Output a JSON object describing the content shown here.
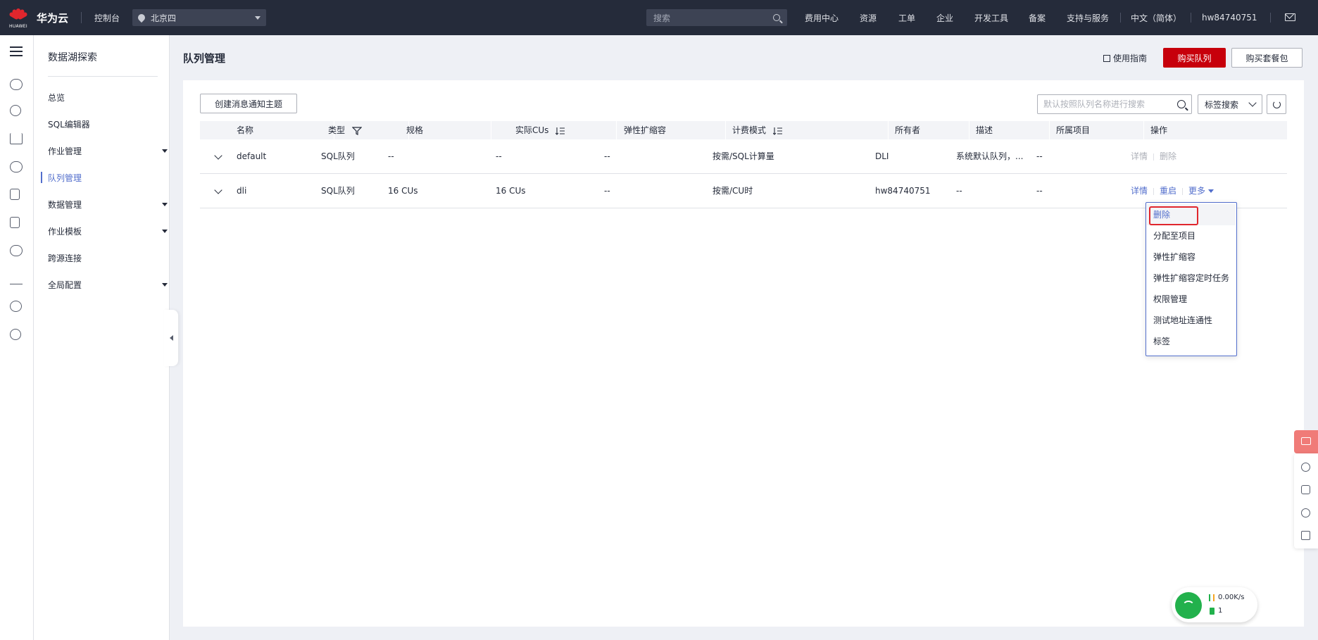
{
  "topbar": {
    "brand": "华为云",
    "logo_text": "HUAWEI",
    "console": "控制台",
    "region": "北京四",
    "search_placeholder": "搜索",
    "nav": [
      "费用中心",
      "资源",
      "工单",
      "企业",
      "开发工具",
      "备案",
      "支持与服务",
      "中文（简体）",
      "hw84740751"
    ]
  },
  "sidemenu": {
    "title": "数据湖探索",
    "items": [
      {
        "label": "总览",
        "has_children": false
      },
      {
        "label": "SQL编辑器",
        "has_children": false
      },
      {
        "label": "作业管理",
        "has_children": true
      },
      {
        "label": "队列管理",
        "has_children": false,
        "active": true
      },
      {
        "label": "数据管理",
        "has_children": true
      },
      {
        "label": "作业模板",
        "has_children": true
      },
      {
        "label": "跨源连接",
        "has_children": false
      },
      {
        "label": "全局配置",
        "has_children": true
      }
    ]
  },
  "page": {
    "title": "队列管理",
    "guide": "使用指南",
    "buy_queue": "购买队列",
    "buy_package": "购买套餐包"
  },
  "toolbar": {
    "create_topic": "创建消息通知主题",
    "search_placeholder": "默认按照队列名称进行搜索",
    "tag_search": "标签搜索"
  },
  "table": {
    "columns": [
      "名称",
      "类型",
      "规格",
      "实际CUs",
      "弹性扩缩容",
      "计费模式",
      "所有者",
      "描述",
      "所属项目",
      "操作"
    ],
    "rows": [
      {
        "name": "default",
        "type": "SQL队列",
        "spec": "--",
        "actual_cus": "--",
        "elastic": "--",
        "billing": "按需/SQL计算量",
        "owner": "DLI",
        "desc": "系统默认队列，...",
        "project": "--",
        "ops": [
          "详情",
          "删除"
        ]
      },
      {
        "name": "dli",
        "type": "SQL队列",
        "spec": "16 CUs",
        "actual_cus": "16 CUs",
        "elastic": "--",
        "billing": "按需/CU时",
        "owner": "hw84740751",
        "desc": "--",
        "project": "--",
        "ops": [
          "详情",
          "重启",
          "更多"
        ]
      }
    ]
  },
  "dropdown": {
    "items": [
      "删除",
      "分配至项目",
      "弹性扩缩容",
      "弹性扩缩容定时任务",
      "权限管理",
      "测试地址连通性",
      "标签"
    ]
  },
  "network_widget": {
    "speed": "0.00K/s",
    "count": "1"
  },
  "colors": {
    "topbar": "#252b3a",
    "primary_red": "#c7000b",
    "link_blue": "#526ecc",
    "highlight_red": "#e0262d"
  }
}
